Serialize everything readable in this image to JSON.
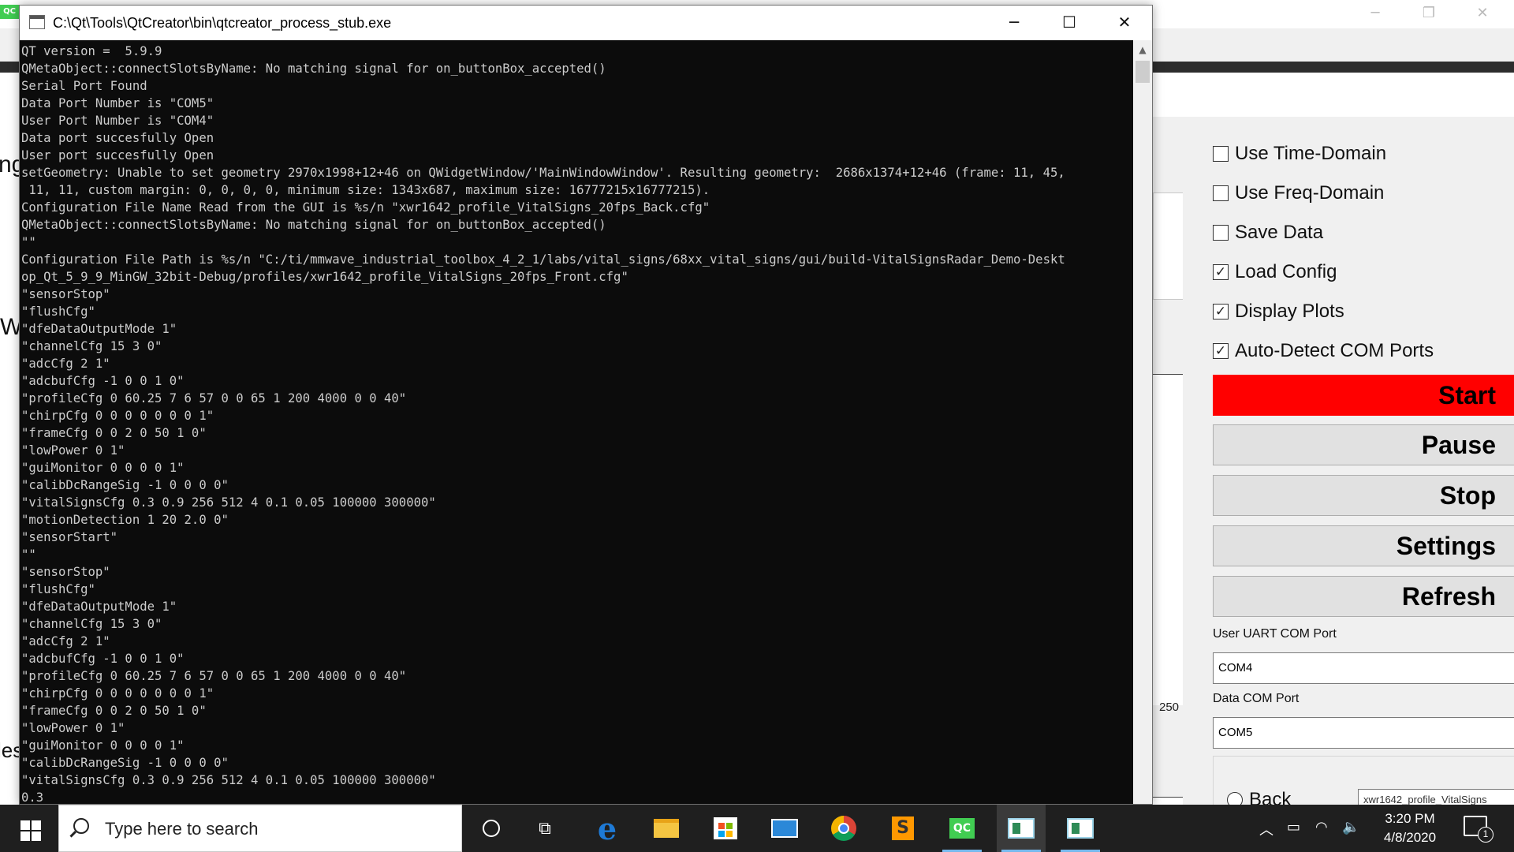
{
  "background_app": {
    "fragments": [
      "ng",
      "W",
      "les"
    ],
    "checkboxes": [
      {
        "label": "Use Time-Domain",
        "checked": false
      },
      {
        "label": "Use Freq-Domain",
        "checked": false
      },
      {
        "label": "Save Data",
        "checked": false
      },
      {
        "label": "Load Config",
        "checked": true
      },
      {
        "label": "Display Plots",
        "checked": true
      },
      {
        "label": "Auto-Detect COM Ports",
        "checked": true
      }
    ],
    "buttons": {
      "start": "Start",
      "pause": "Pause",
      "stop": "Stop",
      "settings": "Settings",
      "refresh": "Refresh"
    },
    "user_port_label": "User UART COM Port",
    "user_port_value": "COM4",
    "data_port_label": "Data COM Port",
    "data_port_value": "COM5",
    "back_radio_label": "Back",
    "profile_field_value": "xwr1642_profile_VitalSigns",
    "plot_tick_label": "250",
    "accent_color": "#ff0000"
  },
  "console": {
    "title": "C:\\Qt\\Tools\\QtCreator\\bin\\qtcreator_process_stub.exe",
    "lines": [
      "QT version =  5.9.9",
      "QMetaObject::connectSlotsByName: No matching signal for on_buttonBox_accepted()",
      "Serial Port Found",
      "Data Port Number is \"COM5\"",
      "User Port Number is \"COM4\"",
      "Data port succesfully Open",
      "User port succesfully Open",
      "setGeometry: Unable to set geometry 2970x1998+12+46 on QWidgetWindow/'MainWindowWindow'. Resulting geometry:  2686x1374+12+46 (frame: 11, 45,",
      " 11, 11, custom margin: 0, 0, 0, 0, minimum size: 1343x687, maximum size: 16777215x16777215).",
      "Configuration File Name Read from the GUI is %s/n \"xwr1642_profile_VitalSigns_20fps_Back.cfg\"",
      "QMetaObject::connectSlotsByName: No matching signal for on_buttonBox_accepted()",
      "\"\"",
      "Configuration File Path is %s/n \"C:/ti/mmwave_industrial_toolbox_4_2_1/labs/vital_signs/68xx_vital_signs/gui/build-VitalSignsRadar_Demo-Deskt",
      "op_Qt_5_9_9_MinGW_32bit-Debug/profiles/xwr1642_profile_VitalSigns_20fps_Front.cfg\"",
      "\"sensorStop\"",
      "\"flushCfg\"",
      "\"dfeDataOutputMode 1\"",
      "\"channelCfg 15 3 0\"",
      "\"adcCfg 2 1\"",
      "\"adcbufCfg -1 0 0 1 0\"",
      "\"profileCfg 0 60.25 7 6 57 0 0 65 1 200 4000 0 0 40\"",
      "\"chirpCfg 0 0 0 0 0 0 0 1\"",
      "\"frameCfg 0 0 2 0 50 1 0\"",
      "\"lowPower 0 1\"",
      "\"guiMonitor 0 0 0 0 1\"",
      "\"calibDcRangeSig -1 0 0 0 0\"",
      "\"vitalSignsCfg 0.3 0.9 256 512 4 0.1 0.05 100000 300000\"",
      "\"motionDetection 1 20 2.0 0\"",
      "\"sensorStart\"",
      "\"\"",
      "\"sensorStop\"",
      "\"flushCfg\"",
      "\"dfeDataOutputMode 1\"",
      "\"channelCfg 15 3 0\"",
      "\"adcCfg 2 1\"",
      "\"adcbufCfg -1 0 0 1 0\"",
      "\"profileCfg 0 60.25 7 6 57 0 0 65 1 200 4000 0 0 40\"",
      "\"chirpCfg 0 0 0 0 0 0 0 1\"",
      "\"frameCfg 0 0 2 0 50 1 0\"",
      "\"lowPower 0 1\"",
      "\"guiMonitor 0 0 0 0 1\"",
      "\"calibDcRangeSig -1 0 0 0 0\"",
      "\"vitalSignsCfg 0.3 0.9 256 512 4 0.1 0.05 100000 300000\"",
      "0.3"
    ]
  },
  "taskbar": {
    "search_placeholder": "Type here to search",
    "apps": [
      "cortana-icon",
      "task-view-icon",
      "edge-icon",
      "file-explorer-icon",
      "store-icon",
      "mail-icon",
      "chrome-icon",
      "sublime-icon",
      "qt-creator-icon",
      "vitalsigns-app-icon",
      "console-app-icon"
    ],
    "qt_icon_text": "QC",
    "time": "3:20 PM",
    "date": "4/8/2020",
    "notification_count": "1"
  }
}
